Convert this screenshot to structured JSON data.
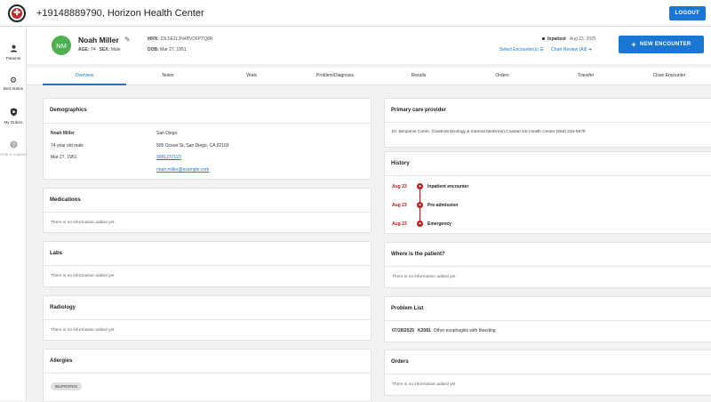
{
  "header": {
    "title": "+19148889790, Horizon Health Center",
    "logout_label": "LOGOUT"
  },
  "sidebar": {
    "items": [
      {
        "label": "Patients",
        "icon": "person-icon"
      },
      {
        "label": "Bed Status",
        "icon": "gear-icon"
      },
      {
        "label": "My Orders",
        "icon": "shield-icon"
      },
      {
        "label": "Help & support",
        "icon": "help-icon"
      }
    ]
  },
  "patient": {
    "initials": "NM",
    "name": "Noah Miller",
    "age_label": "AGE:",
    "age": "74",
    "sex_label": "SEX:",
    "sex": "Male",
    "mrn_label": "MRN:",
    "mrn": "23L5E2L3N4BVD6PTQ8R",
    "dob_label": "DOB:",
    "dob": "Mar 27, 1951",
    "encounter_type": "Inpatient",
    "encounter_date": "Aug 23, 2025",
    "select_encounters": "Select Encounter(s) ☰",
    "chart_review": "Chart Review (All) ➜",
    "new_encounter_label": "NEW ENCOUNTER"
  },
  "tabs": [
    "Overview",
    "Notes",
    "Vitals",
    "Problem/Diagnosis",
    "Results",
    "Orders",
    "Transfer",
    "Close Encounter"
  ],
  "demographics": {
    "title": "Demographics",
    "name": "Noah Miller",
    "age_sex": "74 year old male",
    "dob": "Mar 27, 1951",
    "city": "San Diego",
    "address": "505 Ocean St, San Diego, CA 92103",
    "phone": "9081237123",
    "email": "noah.miller@example.com"
  },
  "cards": {
    "medications": {
      "title": "Medications",
      "empty": "There is no information added yet"
    },
    "labs": {
      "title": "Labs",
      "empty": "There is no information added yet"
    },
    "radiology": {
      "title": "Radiology",
      "empty": "There is no information added yet"
    },
    "allergies": {
      "title": "Allergies",
      "chip": "IBUPROFEN"
    },
    "pcp": {
      "title": "Primary care provider",
      "text": "Dr. Benjamin Carter, (Gastroenterology & Internal Medicine),Coastal GE Health Center,(555) 234-5678"
    },
    "history": {
      "title": "History",
      "items": [
        {
          "date": "Aug 23",
          "label": "Inpatient encounter"
        },
        {
          "date": "Aug 23",
          "label": "Pre-admission"
        },
        {
          "date": "Aug 23",
          "label": "Emergency"
        }
      ]
    },
    "location": {
      "title": "Where is the patient?",
      "empty": "There is no information added yet"
    },
    "problems": {
      "title": "Problem List",
      "items": [
        {
          "date": "07/28/2025",
          "code": "K2081",
          "text": "Other esophagitis with bleeding"
        }
      ]
    },
    "orders": {
      "title": "Orders",
      "empty": "There is no information added yet"
    }
  },
  "colors": {
    "primary": "#1976d2",
    "avatar": "#4caf50",
    "history_accent": "#b71c1c"
  }
}
